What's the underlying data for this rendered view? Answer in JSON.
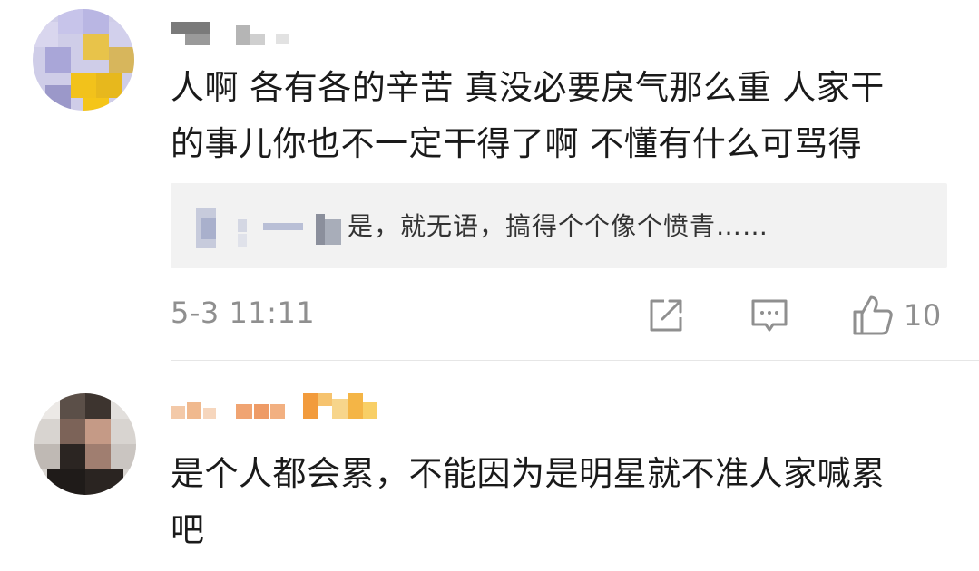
{
  "comments": [
    {
      "username": "",
      "text_line1": "人啊 各有各的辛苦 真没必要戾气那么重 人家干",
      "text_line2": "的事儿你也不一定干得了啊 不懂有什么可骂得",
      "reply_preview": "是，就无语，搞得个个像个愤青……",
      "timestamp": "5-3 11:11",
      "like_count": "10",
      "icons": [
        "share-icon",
        "comment-icon",
        "like-icon"
      ]
    },
    {
      "username": "",
      "text_line1": "是个人都会累，不能因为是明星就不准人家喊累",
      "text_line2": "吧"
    }
  ],
  "colors": {
    "text": "#1a1a1a",
    "meta": "#8f8f8f",
    "quote_bg": "#f2f2f2"
  }
}
